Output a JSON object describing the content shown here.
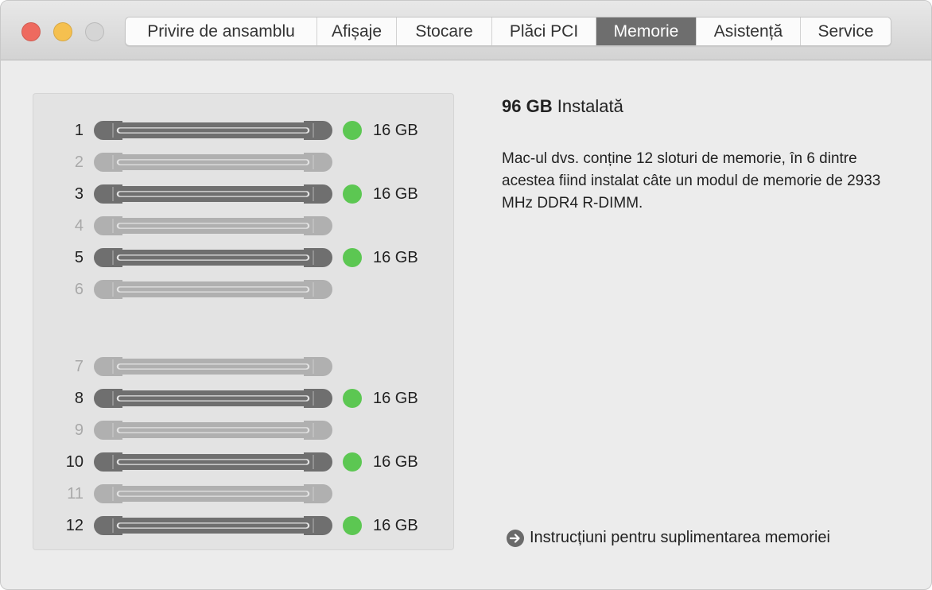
{
  "window": {
    "controls": [
      {
        "name": "close",
        "color": "#ee6a5f"
      },
      {
        "name": "minimize",
        "color": "#f5c04f"
      },
      {
        "name": "zoom",
        "color": "#d5d5d5"
      }
    ]
  },
  "tabs": [
    {
      "label": "Privire de ansamblu",
      "active": false
    },
    {
      "label": "Afișaje",
      "active": false
    },
    {
      "label": "Stocare",
      "active": false
    },
    {
      "label": "Plăci PCI",
      "active": false
    },
    {
      "label": "Memorie",
      "active": true
    },
    {
      "label": "Asistență",
      "active": false
    },
    {
      "label": "Service",
      "active": false
    }
  ],
  "slots": [
    {
      "number": "1",
      "installed": true,
      "size": "16 GB"
    },
    {
      "number": "2",
      "installed": false,
      "size": ""
    },
    {
      "number": "3",
      "installed": true,
      "size": "16 GB"
    },
    {
      "number": "4",
      "installed": false,
      "size": ""
    },
    {
      "number": "5",
      "installed": true,
      "size": "16 GB"
    },
    {
      "number": "6",
      "installed": false,
      "size": ""
    },
    {
      "number": "7",
      "installed": false,
      "size": ""
    },
    {
      "number": "8",
      "installed": true,
      "size": "16 GB"
    },
    {
      "number": "9",
      "installed": false,
      "size": ""
    },
    {
      "number": "10",
      "installed": true,
      "size": "16 GB"
    },
    {
      "number": "11",
      "installed": false,
      "size": ""
    },
    {
      "number": "12",
      "installed": true,
      "size": "16 GB"
    }
  ],
  "info": {
    "total_amount": "96 GB",
    "total_label": "Instalată",
    "description": "Mac-ul dvs. conține 12 sloturi de memorie, în 6 dintre acestea fiind instalat câte un modul de memorie de 2933 MHz DDR4 R-DIMM."
  },
  "link": {
    "label": "Instrucțiuni pentru suplimentarea memoriei",
    "icon": "arrow-right-circle-icon"
  },
  "colors": {
    "installed_slot": "#6f6f6f",
    "empty_slot": "#b0b0b0",
    "check": "#5cc752",
    "active_tab": "#6e6e6e"
  }
}
